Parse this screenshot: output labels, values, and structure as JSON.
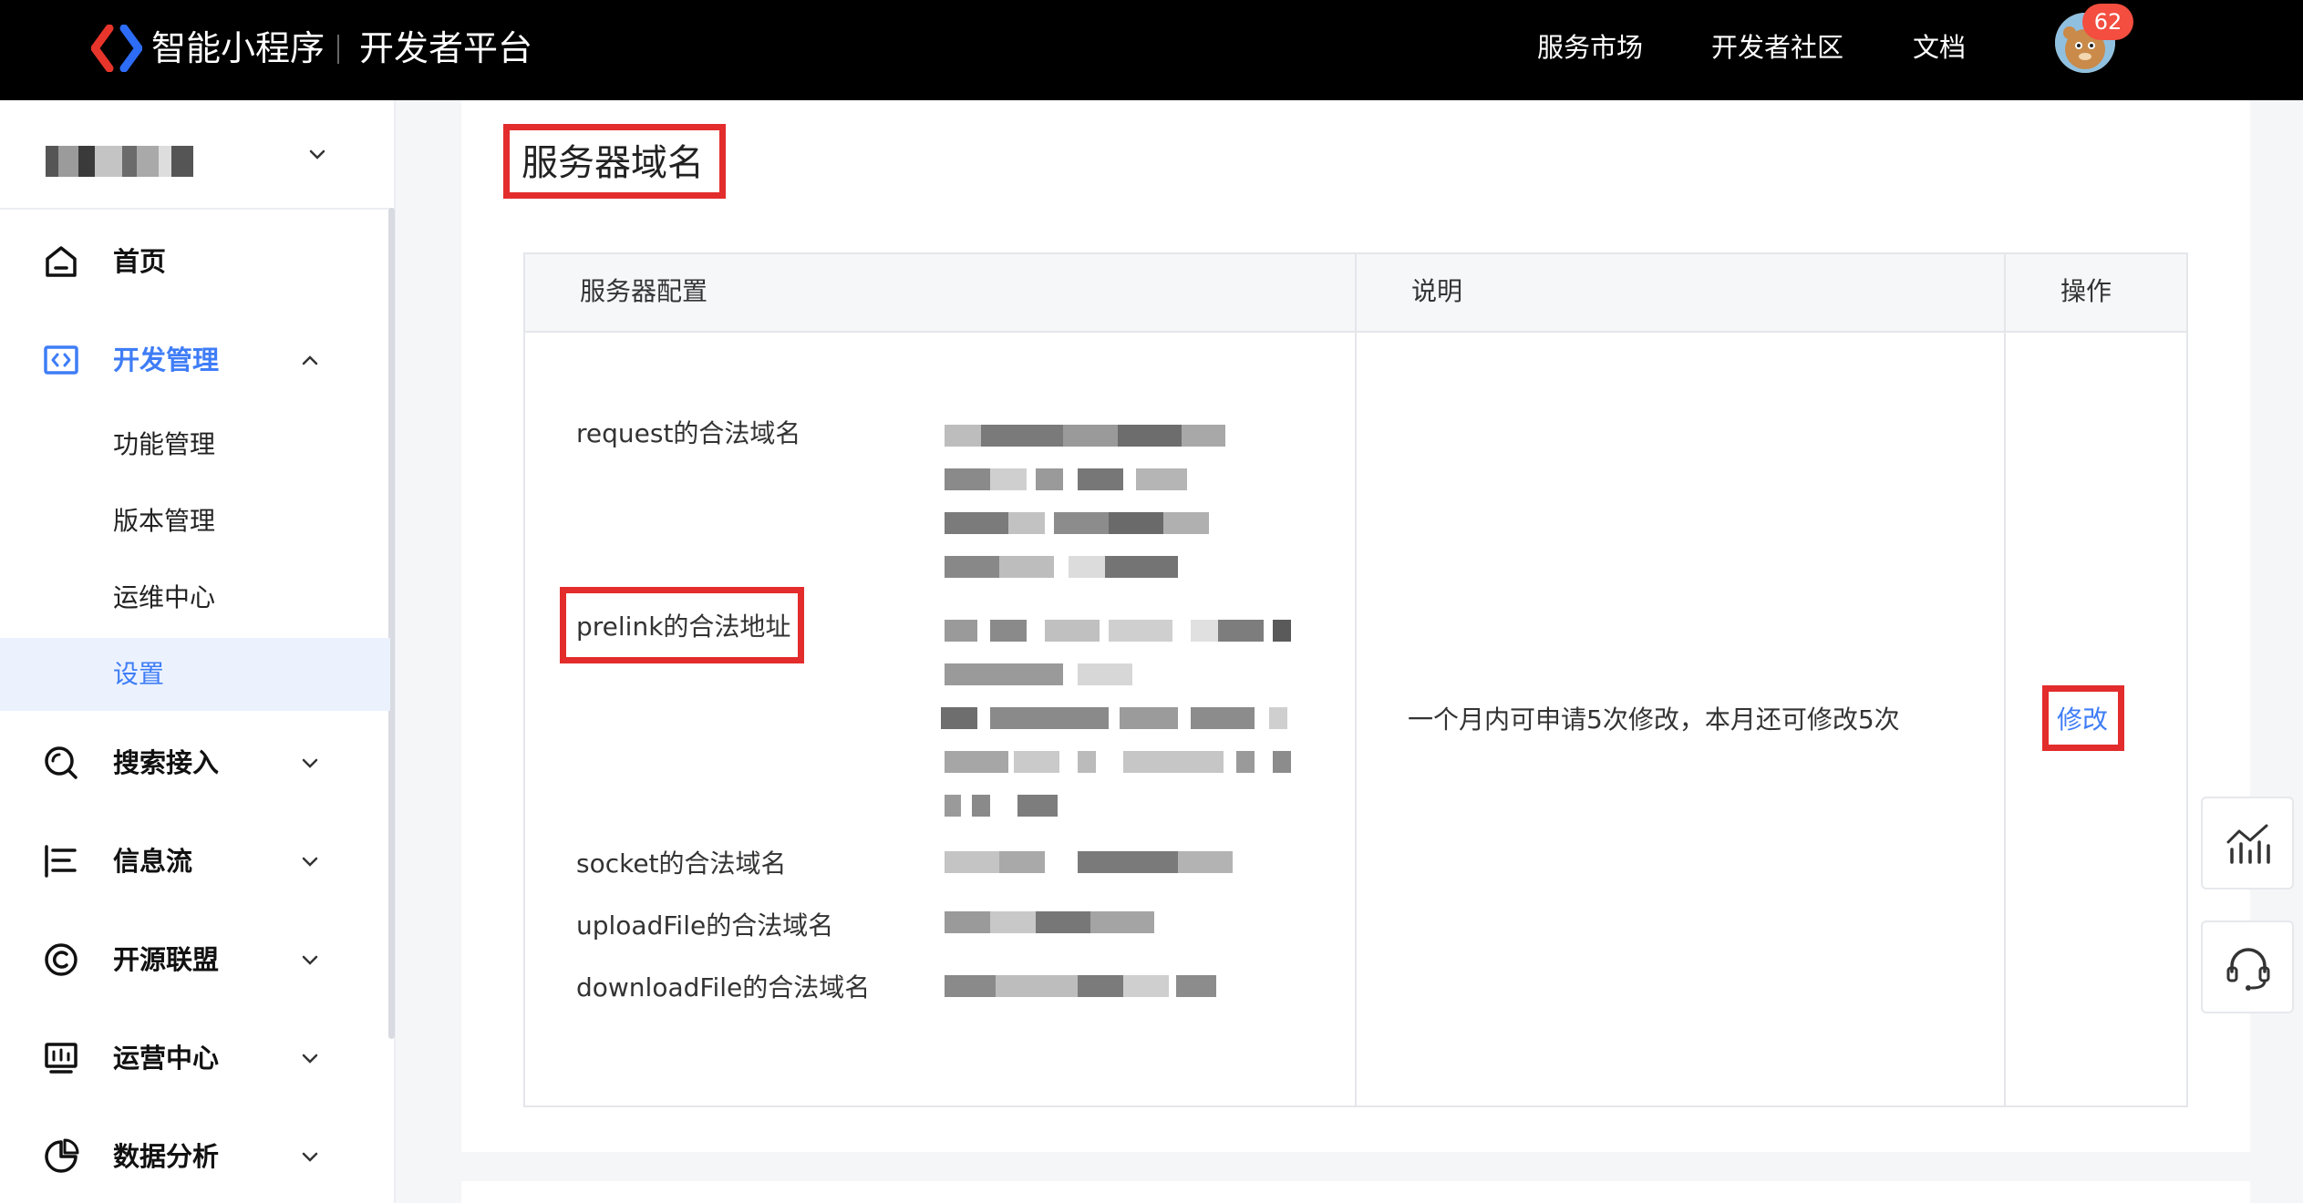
{
  "header": {
    "brand": "智能小程序",
    "subtitle": "开发者平台",
    "nav": [
      "服务市场",
      "开发者社区",
      "文档"
    ],
    "notification_count": "62"
  },
  "sidebar": {
    "menu": [
      {
        "label": "首页",
        "icon": "home-icon"
      },
      {
        "label": "开发管理",
        "icon": "code-icon",
        "expanded": true
      },
      {
        "label": "搜索接入",
        "icon": "search-icon"
      },
      {
        "label": "信息流",
        "icon": "feed-icon"
      },
      {
        "label": "开源联盟",
        "icon": "alliance-icon"
      },
      {
        "label": "运营中心",
        "icon": "operations-icon"
      },
      {
        "label": "数据分析",
        "icon": "analytics-icon"
      }
    ],
    "submenu": [
      "功能管理",
      "版本管理",
      "运维中心",
      "设置"
    ],
    "selected_submenu": "设置"
  },
  "main": {
    "section_title": "服务器域名",
    "table": {
      "headers": [
        "服务器配置",
        "说明",
        "操作"
      ],
      "rows": [
        "request的合法域名",
        "prelink的合法地址",
        "socket的合法域名",
        "uploadFile的合法域名",
        "downloadFile的合法域名"
      ],
      "description": "一个月内可申请5次修改，本月还可修改5次",
      "action": "修改"
    }
  },
  "colors": {
    "accent": "#3f7df6",
    "highlight": "#e32c2c",
    "topbar": "#000000"
  }
}
